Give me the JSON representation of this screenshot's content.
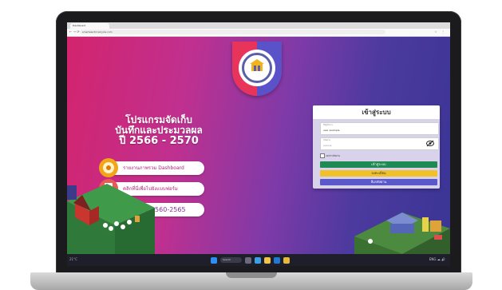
{
  "browser": {
    "tab_title": "Dashboard",
    "url": "smartelectricalcycle.com",
    "nav_icons": "← → ⟳",
    "right_icons": "☆ ⋮"
  },
  "hero": {
    "title_line1": "โปรแกรมจัดเก็บ",
    "title_line2": "บันทึกและประมวลผล",
    "title_line3": "ปี 2566 - 2570"
  },
  "menu": [
    {
      "label": "รายงานภาพรวม Dashboard",
      "icon": "dashboard-icon",
      "color": "#f2a516"
    },
    {
      "label": "คลิกที่นี่เพื่อไปยังแบบฟอร์ม",
      "icon": "form-icon",
      "color": "#ea5a55"
    },
    {
      "label": "รายงานปี 2560-2565",
      "icon": "report-icon",
      "color": "#2bb3c8"
    }
  ],
  "login": {
    "title": "เข้าสู่ระบบ",
    "username_label": "ชื่อผู้ใช้งาน",
    "username_value": "user example",
    "password_label": "รหัสผ่าน",
    "password_value": "••••••",
    "eye_icon": "eye-slash-icon",
    "remember_label": "จดจำรหัสผ่าน",
    "login_button": "เข้าสู่ระบบ",
    "register_button": "ลงทะเบียน",
    "forgot_button": "ลืมรหัสผ่าน"
  },
  "taskbar": {
    "search_placeholder": "Search",
    "left_text": "21°C",
    "right_text": "ENG  ☁  🔊"
  },
  "colors": {
    "gradient_start": "#d3246e",
    "gradient_end": "#3a3594",
    "login_green": "#1f8a53",
    "register_yellow": "#f0c12a",
    "forgot_blue": "#5b59c9"
  }
}
